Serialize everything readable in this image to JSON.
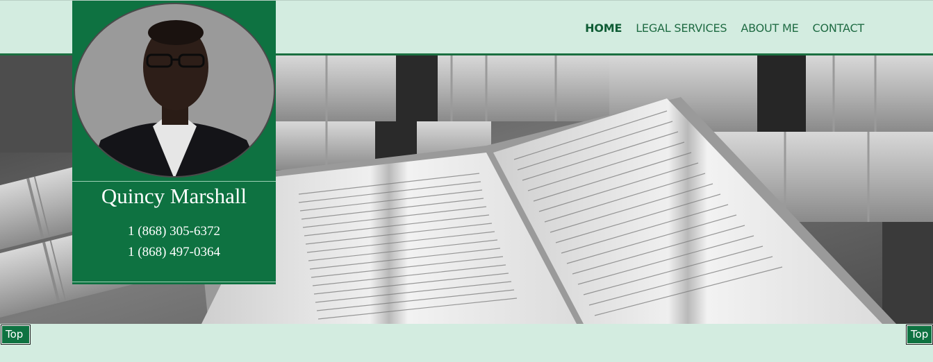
{
  "nav": {
    "items": [
      {
        "label": "HOME",
        "active": true
      },
      {
        "label": "LEGAL SERVICES",
        "active": false
      },
      {
        "label": "ABOUT ME",
        "active": false
      },
      {
        "label": "CONTACT",
        "active": false
      }
    ]
  },
  "profile": {
    "name": "Quincy Marshall",
    "phone_1": "1 (868) 305-6372",
    "phone_2": "1 (868) 497-0364"
  },
  "buttons": {
    "top_left": "Top",
    "top_right": "Top"
  },
  "colors": {
    "background": "#d3ece0",
    "brand_green": "#0e7241",
    "nav_text": "#1f6b43"
  }
}
